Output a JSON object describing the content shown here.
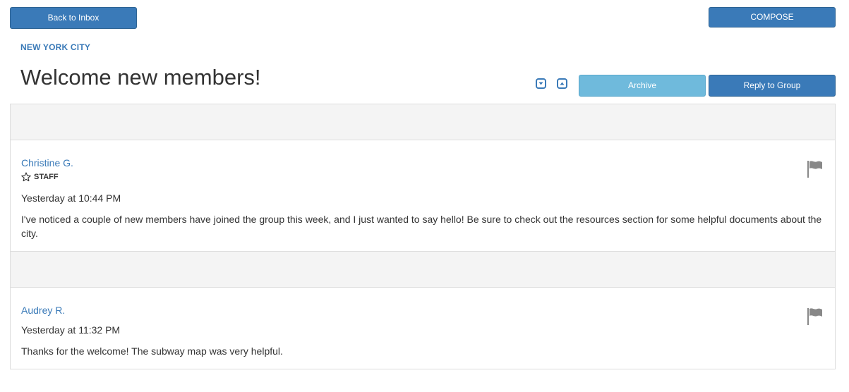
{
  "toolbar": {
    "back_label": "Back to Inbox",
    "compose_label": "COMPOSE"
  },
  "group": {
    "name": "NEW YORK CITY"
  },
  "thread": {
    "title": "Welcome new members!",
    "archive_label": "Archive",
    "reply_label": "Reply to Group",
    "nav_icons": [
      "arrow-down-icon",
      "arrow-up-icon"
    ]
  },
  "messages": [
    {
      "author": "Christine G.",
      "badge": "STAFF",
      "badge_icon": "star-outline-icon",
      "timestamp": "Yesterday at 10:44 PM",
      "text": "I've noticed a couple of new members have joined the group this week, and I just wanted to say hello! Be sure to check out the resources section for some helpful documents about the city.",
      "action_icon": "flag-icon"
    },
    {
      "author": "Audrey R.",
      "timestamp": "Yesterday at 11:32 PM",
      "text": "Thanks for the welcome! The subway map was very helpful.",
      "action_icon": "flag-icon"
    }
  ],
  "colors": {
    "primary": "#3a7ab8",
    "info": "#6fbadc",
    "panel_header": "#f4f4f4",
    "border": "#dddddd",
    "text": "#333333"
  }
}
